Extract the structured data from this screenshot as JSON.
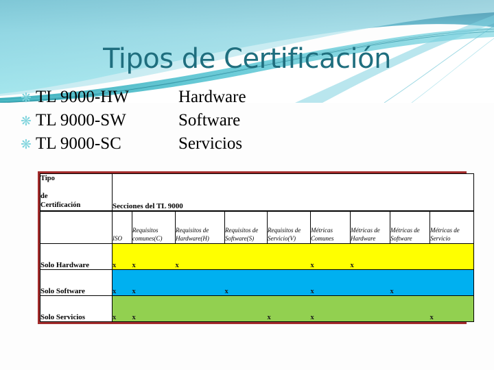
{
  "slide": {
    "title": "Tipos de Certificación",
    "accent_color": "#1f6e7e",
    "bullet_glyph": "❋",
    "bullet_color": "#7fd4dd"
  },
  "bullets": [
    {
      "code": "TL 9000-HW",
      "desc": "Hardware"
    },
    {
      "code": "TL 9000-SW",
      "desc": "Software"
    },
    {
      "code": "TL 9000-SC",
      "desc": "Servicios"
    }
  ],
  "table": {
    "border_color": "#a32c2c",
    "corner_header_line1": "Tipo",
    "corner_header_line1b": "de",
    "corner_header_line2": "Certificación",
    "group_header": "Secciones del TL 9000",
    "columns": [
      {
        "key": "iso",
        "label": "ISO"
      },
      {
        "key": "reqc",
        "label": "Requisitos comunes(C)"
      },
      {
        "key": "reqh",
        "label": "Requisitos de Hardware(H)"
      },
      {
        "key": "reqs",
        "label": "Requisitos de Software(S)"
      },
      {
        "key": "reqv",
        "label": "Requisitos de Servicio(V)"
      },
      {
        "key": "mc",
        "label": "Métricas Comunes"
      },
      {
        "key": "mh",
        "label": "Métricas de Hardware"
      },
      {
        "key": "ms",
        "label": "Métricas de Software"
      },
      {
        "key": "msv",
        "label": "Métricas de Servicio"
      }
    ],
    "mark": "x",
    "rows": [
      {
        "label": "Solo Hardware",
        "color": "#ffff00",
        "cells": [
          "x",
          "x",
          "x",
          "",
          "",
          "x",
          "x",
          "",
          ""
        ]
      },
      {
        "label": "Solo Software",
        "color": "#00b0f0",
        "cells": [
          "x",
          "x",
          "",
          "x",
          "",
          "x",
          "",
          "x",
          ""
        ]
      },
      {
        "label": "Solo Servicios",
        "color": "#92d050",
        "cells": [
          "x",
          "x",
          "",
          "",
          "x",
          "x",
          "",
          "",
          "x"
        ]
      }
    ]
  }
}
